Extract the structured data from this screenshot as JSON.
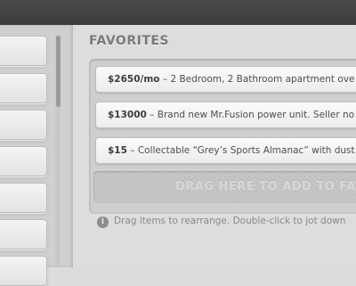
{
  "favorites": {
    "title": "FAVORITES",
    "items": [
      {
        "price": "$2650/mo",
        "description": " – 2 Bedroom, 2 Bathroom apartment ove"
      },
      {
        "price": "$13000",
        "description": " – Brand new Mr.Fusion power unit. Seller no"
      },
      {
        "price": "$15",
        "description": " – Collectable “Grey’s Sports Almanac” with dust"
      }
    ],
    "drop_zone_text": "DRAG HERE TO ADD TO FAV",
    "hint_icon": "info-icon",
    "hint_icon_glyph": "i",
    "hint_text": "Drag items to rearrange. Double-click to jot down"
  },
  "colors": {
    "topbar": "#3c3c3c",
    "background": "#dcdcdc",
    "title": "#7a7a7a"
  }
}
